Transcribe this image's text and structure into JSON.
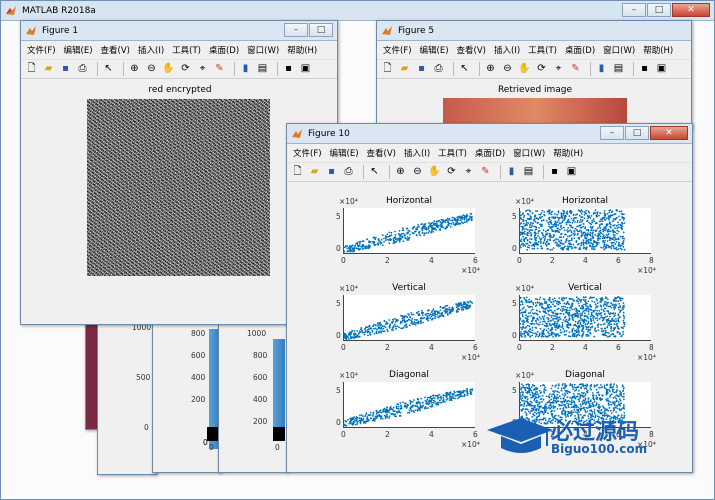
{
  "main_window": {
    "title": "MATLAB R2018a"
  },
  "menu_items": [
    "文件(F)",
    "编辑(E)",
    "查看(V)",
    "插入(I)",
    "工具(T)",
    "桌面(D)",
    "窗口(W)",
    "帮助(H)"
  ],
  "figure1": {
    "title": "Figure 1",
    "plot_title": "red encrypted"
  },
  "figure5": {
    "title": "Figure 5",
    "plot_title": "Retrieved image"
  },
  "figure10": {
    "title": "Figure 10",
    "exponent_label": "×10⁴",
    "x_ticks": [
      "0",
      "2",
      "4",
      "6"
    ],
    "x_ticks_right": [
      "0",
      "2",
      "4",
      "6",
      "8"
    ],
    "y_ticks": [
      "0",
      "5"
    ],
    "subplots": [
      {
        "title": "Horizontal"
      },
      {
        "title": "Horizontal"
      },
      {
        "title": "Vertical"
      },
      {
        "title": "Vertical"
      },
      {
        "title": "Diagonal"
      },
      {
        "title": "Diagonal"
      }
    ]
  },
  "background_windows": {
    "y_ticks_a": [
      "1000",
      "500",
      "0"
    ],
    "y_ticks_b": [
      "800",
      "600",
      "400",
      "200"
    ],
    "y_ticks_c": [
      "1000",
      "800",
      "600",
      "400",
      "200",
      "0"
    ],
    "x_tick_a": "0",
    "x_tick_b": "0",
    "x_tick_c": "0"
  },
  "watermark": {
    "text": "必过源码",
    "url": "Biguo100.com"
  },
  "colors": {
    "scatter": "#0072bd",
    "titlebar": "#dbe6f3"
  }
}
